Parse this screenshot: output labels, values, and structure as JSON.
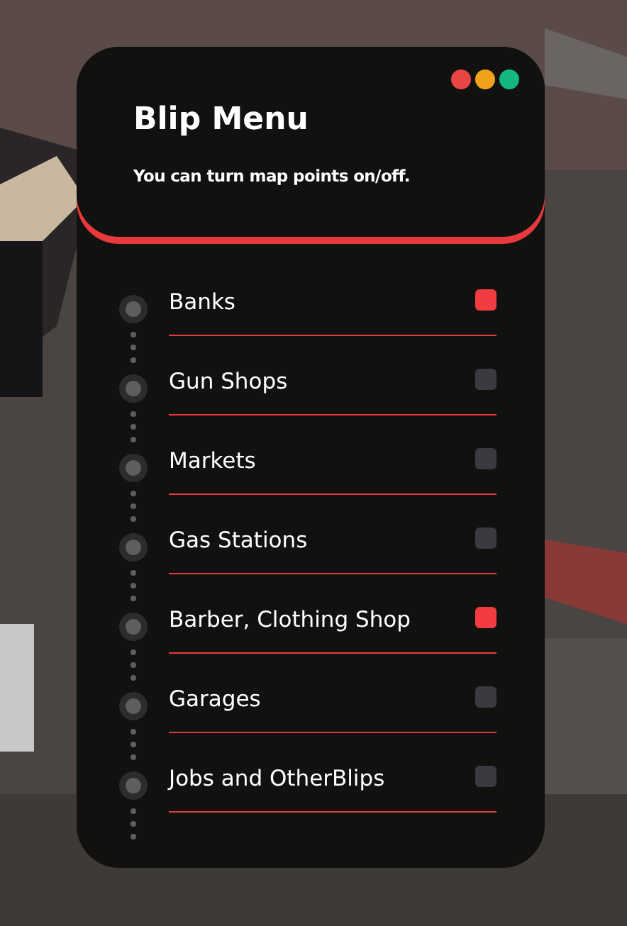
{
  "header": {
    "title": "Blip Menu",
    "subtitle": "You can turn map points on/off."
  },
  "blips": [
    {
      "label": "Banks",
      "checked": true
    },
    {
      "label": "Gun Shops",
      "checked": false
    },
    {
      "label": "Markets",
      "checked": false
    },
    {
      "label": "Gas Stations",
      "checked": false
    },
    {
      "label": "Barber, Clothing Shop",
      "checked": true
    },
    {
      "label": "Garages",
      "checked": false
    },
    {
      "label": "Jobs and OtherBlips",
      "checked": false
    }
  ]
}
